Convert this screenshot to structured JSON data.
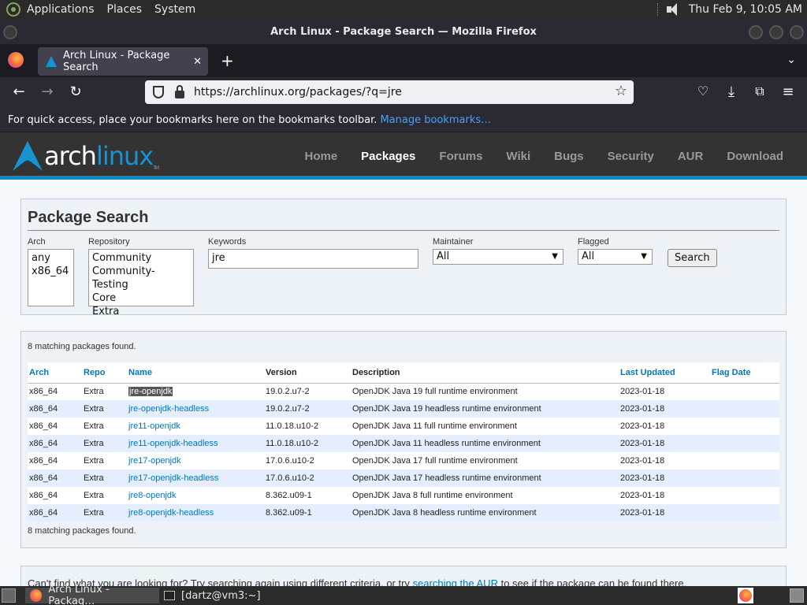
{
  "panel": {
    "menus": [
      "Applications",
      "Places",
      "System"
    ],
    "clock": "Thu Feb  9, 10:05 AM"
  },
  "window": {
    "title": "Arch Linux - Package Search — Mozilla Firefox"
  },
  "browser": {
    "tab_title": "Arch Linux - Package Search",
    "url": "https://archlinux.org/packages/?q=jre",
    "bookmarks_hint": "For quick access, place your bookmarks here on the bookmarks toolbar.",
    "bookmarks_link": "Manage bookmarks…"
  },
  "site": {
    "logo_main": "arch",
    "logo_accent": "linux",
    "logo_tm": "TM",
    "nav": [
      "Home",
      "Packages",
      "Forums",
      "Wiki",
      "Bugs",
      "Security",
      "AUR",
      "Download"
    ],
    "active_nav": "Packages",
    "accent_color": "#1793d1"
  },
  "search": {
    "title": "Package Search",
    "arch_label": "Arch",
    "arch_options": [
      "any",
      "x86_64"
    ],
    "repo_label": "Repository",
    "repo_options": [
      "Community",
      "Community-Testing",
      "Core",
      "Extra"
    ],
    "keywords_label": "Keywords",
    "keywords_value": "jre",
    "maintainer_label": "Maintainer",
    "maintainer_value": "All",
    "flagged_label": "Flagged",
    "flagged_value": "All",
    "button": "Search"
  },
  "results": {
    "count_top": "8 matching packages found.",
    "count_bottom": "8 matching packages found.",
    "headers": [
      "Arch",
      "Repo",
      "Name",
      "Version",
      "Description",
      "Last Updated",
      "Flag Date"
    ],
    "rows": [
      [
        "x86_64",
        "Extra",
        "jre-openjdk",
        "19.0.2.u7-2",
        "OpenJDK Java 19 full runtime environment",
        "2023-01-18",
        ""
      ],
      [
        "x86_64",
        "Extra",
        "jre-openjdk-headless",
        "19.0.2.u7-2",
        "OpenJDK Java 19 headless runtime environment",
        "2023-01-18",
        ""
      ],
      [
        "x86_64",
        "Extra",
        "jre11-openjdk",
        "11.0.18.u10-2",
        "OpenJDK Java 11 full runtime environment",
        "2023-01-18",
        ""
      ],
      [
        "x86_64",
        "Extra",
        "jre11-openjdk-headless",
        "11.0.18.u10-2",
        "OpenJDK Java 11 headless runtime environment",
        "2023-01-18",
        ""
      ],
      [
        "x86_64",
        "Extra",
        "jre17-openjdk",
        "17.0.6.u10-2",
        "OpenJDK Java 17 full runtime environment",
        "2023-01-18",
        ""
      ],
      [
        "x86_64",
        "Extra",
        "jre17-openjdk-headless",
        "17.0.6.u10-2",
        "OpenJDK Java 17 headless runtime environment",
        "2023-01-18",
        ""
      ],
      [
        "x86_64",
        "Extra",
        "jre8-openjdk",
        "8.362.u09-1",
        "OpenJDK Java 8 full runtime environment",
        "2023-01-18",
        ""
      ],
      [
        "x86_64",
        "Extra",
        "jre8-openjdk-headless",
        "8.362.u09-1",
        "OpenJDK Java 8 headless runtime environment",
        "2023-01-18",
        ""
      ]
    ]
  },
  "help": {
    "text_before": "Can't find what you are looking for? Try searching again using different criteria, or try",
    "link": "searching the AUR",
    "text_after": "to see if the package can be found there."
  },
  "taskbar": {
    "tasks": [
      "Arch Linux - Packag…",
      "[dartz@vm3:~]"
    ]
  }
}
